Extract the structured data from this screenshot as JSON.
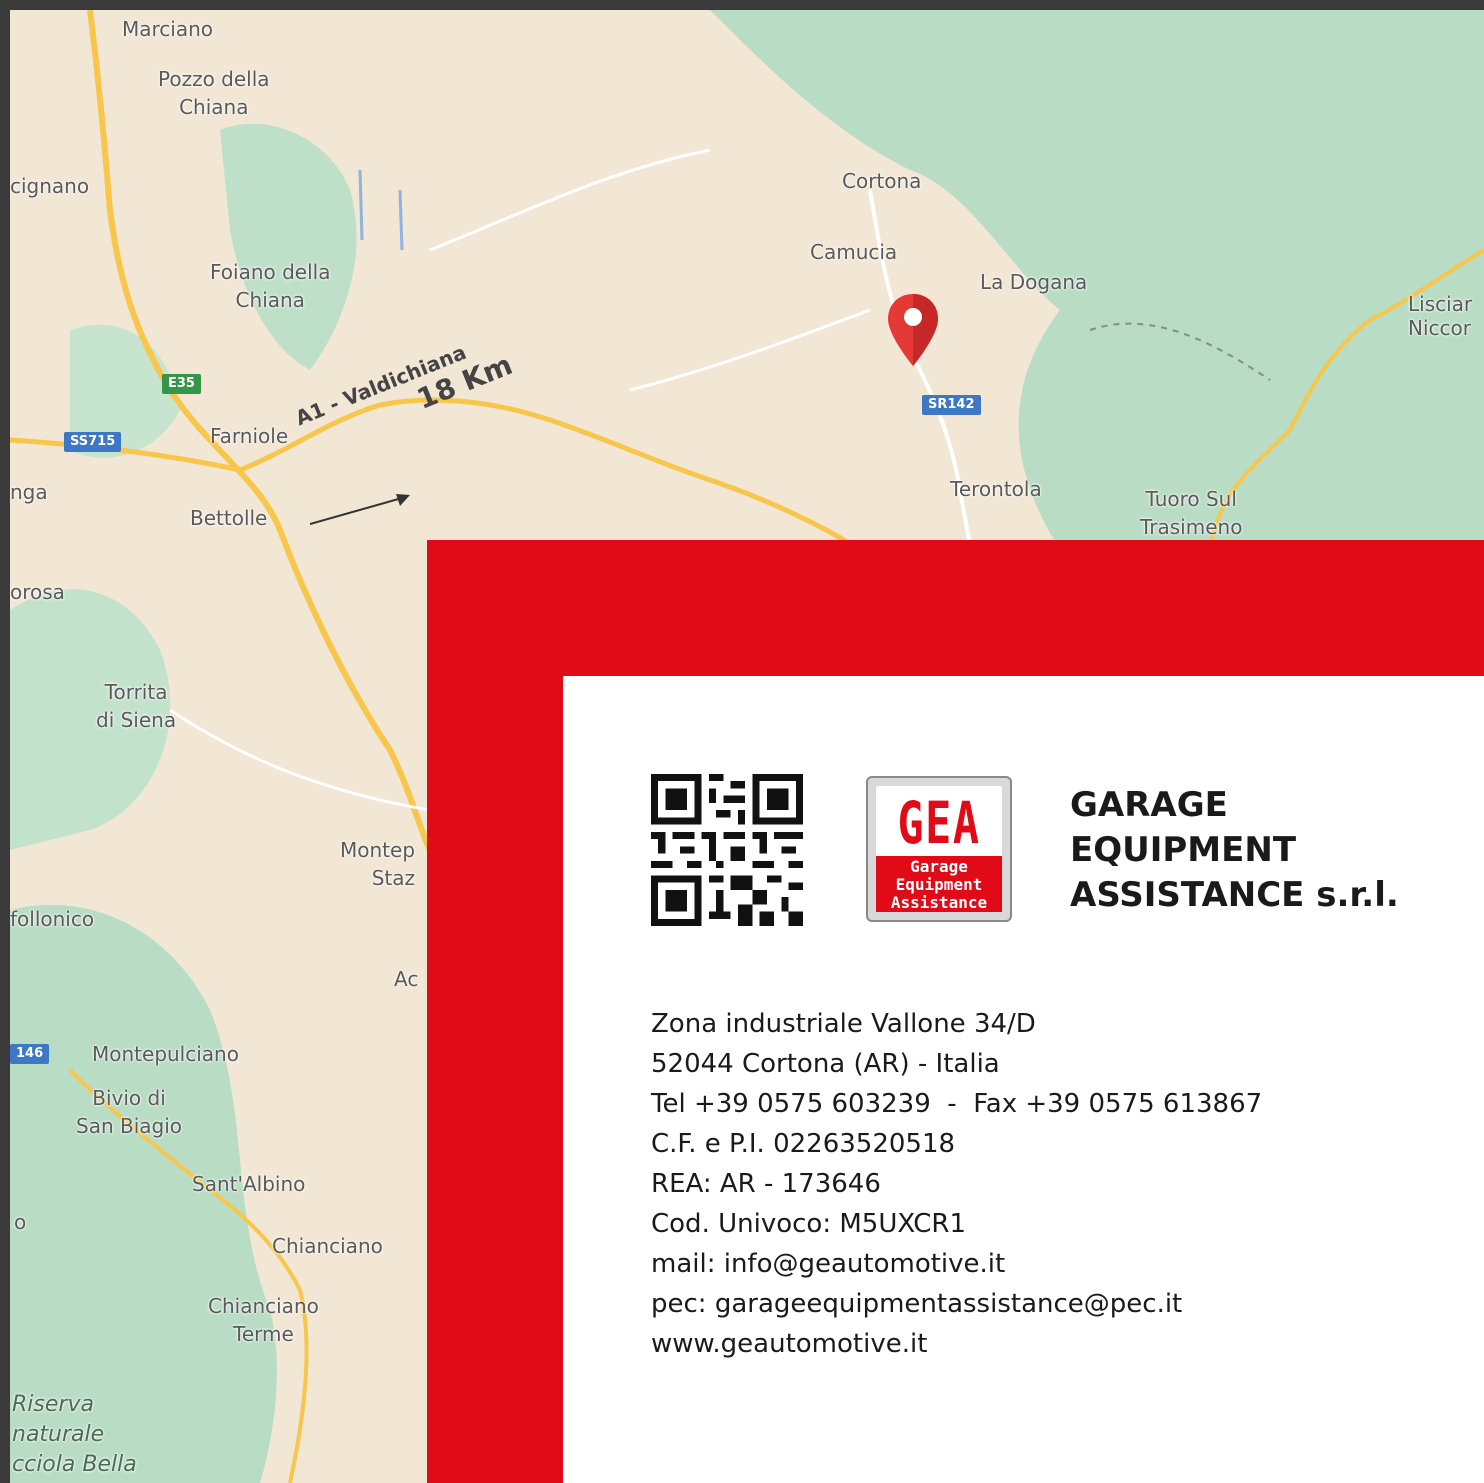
{
  "map": {
    "places": [
      {
        "id": "marciano",
        "label": "Marciano"
      },
      {
        "id": "pozzo",
        "label": "Pozzo della\nChiana"
      },
      {
        "id": "cignano",
        "label": "cignano"
      },
      {
        "id": "cortona",
        "label": "Cortona"
      },
      {
        "id": "camucia",
        "label": "Camucia"
      },
      {
        "id": "ladogana",
        "label": "La Dogana"
      },
      {
        "id": "lisciano",
        "label": "Lisciar\nNiccor"
      },
      {
        "id": "foiano",
        "label": "Foiano della\nChiana"
      },
      {
        "id": "farniole",
        "label": "Farniole"
      },
      {
        "id": "nga",
        "label": "nga"
      },
      {
        "id": "bettolle",
        "label": "Bettolle"
      },
      {
        "id": "terontola",
        "label": "Terontola"
      },
      {
        "id": "tuoro",
        "label": "Tuoro Sul\nTrasimeno"
      },
      {
        "id": "orosa",
        "label": "orosa"
      },
      {
        "id": "torrita",
        "label": "Torrita\ndi Siena"
      },
      {
        "id": "montep",
        "label": "Montep\nStaz"
      },
      {
        "id": "follonico",
        "label": "follonico"
      },
      {
        "id": "ac",
        "label": "Ac"
      },
      {
        "id": "montepulciano",
        "label": "Montepulciano"
      },
      {
        "id": "biviodi",
        "label": "Bivio di\nSan Biagio"
      },
      {
        "id": "santalbino",
        "label": "Sant'Albino"
      },
      {
        "id": "o",
        "label": "o"
      },
      {
        "id": "chianciano",
        "label": "Chianciano"
      },
      {
        "id": "chiancianoterme",
        "label": "Chianciano\nTerme"
      },
      {
        "id": "riserva",
        "label": "Riserva\nnaturale\ncciola Bella"
      }
    ],
    "shields": {
      "e35": "E35",
      "ss715": "SS715",
      "sr142": "SR142",
      "s146": "146"
    },
    "route_label": "A1 - Valdichiana",
    "route_distance": "18 Km",
    "pin_icon": "map-pin-icon",
    "colors": {
      "land": "#f2e6d4",
      "forest": "#b8dcc4",
      "road": "#f7c64b",
      "pin": "#e53935"
    }
  },
  "card": {
    "qr_icon": "qr-code-icon",
    "logo": {
      "mark": "GEA",
      "sub_line1": "Garage",
      "sub_line2": "Equipment",
      "sub_line3": "Assistance"
    },
    "company": {
      "line1": "GARAGE",
      "line2": "EQUIPMENT",
      "line3": "ASSISTANCE s.r.l."
    },
    "info": {
      "address": "Zona industriale Vallone 34/D",
      "city": "52044 Cortona (AR) - Italia",
      "phone": "Tel +39 0575 603239  -  Fax +39 0575 613867",
      "vat": "C.F. e P.I. 02263520518",
      "rea": "REA: AR - 173646",
      "code": "Cod. Univoco: M5UXCR1",
      "mail": "mail: info@geautomotive.it",
      "pec": "pec: garageequipmentassistance@pec.it",
      "web": "www.geautomotive.it"
    },
    "colors": {
      "frame": "#e10a17",
      "text": "#1a1a1a"
    }
  }
}
